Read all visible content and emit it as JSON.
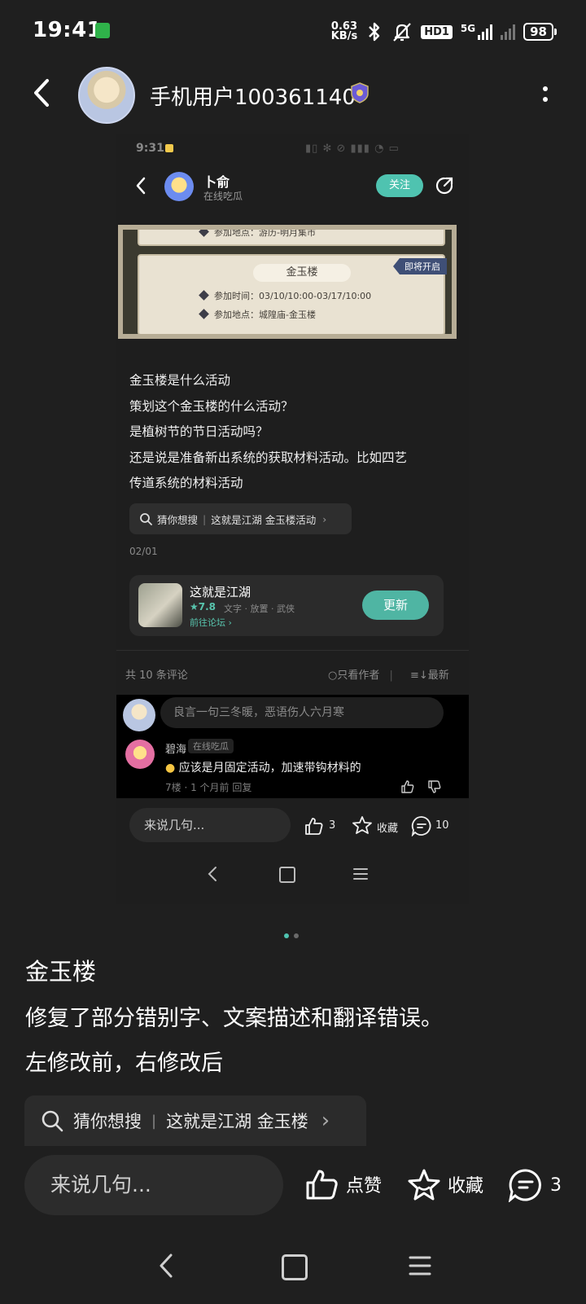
{
  "status_bar": {
    "time": "19:41",
    "net_speed_top": "0.63",
    "net_speed_bottom": "KB/s",
    "hd_label": "HD1",
    "network": "5G",
    "battery": "98"
  },
  "header": {
    "username": "手机用户100361140",
    "icons": [
      "back-arrow-icon",
      "avatar",
      "badge-icon",
      "more-vertical-icon"
    ]
  },
  "embedded_screenshot": {
    "status": {
      "time": "9:31"
    },
    "header": {
      "name": "卜俞",
      "subtitle": "在线吃瓜",
      "follow_label": "关注"
    },
    "game_image": {
      "row1_label": "参加地点：游历-明月集市",
      "card_title": "金玉楼",
      "ribbon": "即将开启",
      "time_label": "参加时间：03/10/10:00-03/17/10:00",
      "place_label": "参加地点：城隍庙-金玉楼"
    },
    "body_lines": [
      "金玉楼是什么活动",
      "策划这个金玉楼的什么活动？",
      "是植树节的节日活动吗？",
      "还是说是准备新出系统的获取材料活动。比如四艺",
      "传道系统的材料活动"
    ],
    "search": {
      "prefix": "猜你想搜",
      "query": "这就是江湖 金玉楼活动"
    },
    "date": "02/01",
    "game_card": {
      "name": "这就是江湖",
      "rating": "★7.8",
      "tags": "文字 · 放置 · 武侠",
      "forum_link": "前往论坛 ›",
      "update_label": "更新"
    },
    "comments_header": {
      "count": "共 10 条评论",
      "author_only": "只看作者",
      "latest": "最新"
    },
    "comment_input_placeholder": "良言一句三冬暖，恶语伤人六月寒",
    "comment": {
      "name": "碧海",
      "tag": "在线吃瓜",
      "text": "应该是月固定活动，加速带钩材料的",
      "meta": "7楼 · 1 个月前  回复"
    },
    "bottom_bar": {
      "input_placeholder": "来说几句...",
      "like_count": "3",
      "fav_label": "收藏",
      "comment_count": "10"
    }
  },
  "carousel": {
    "total": 2,
    "active": 0,
    "active_color": "#4fc3b0",
    "inactive_color": "#6a6a6a"
  },
  "post": {
    "title": "金玉楼",
    "line1": "修复了部分错别字、文案描述和翻译错误。",
    "line2": "左修改前，右修改后"
  },
  "search_suggest": {
    "prefix": "猜你想搜",
    "query": "这就是江湖 金玉楼"
  },
  "bottom_bar": {
    "input_placeholder": "来说几句...",
    "like_label": "点赞",
    "fav_label": "收藏",
    "comment_count": "3"
  },
  "colors": {
    "background": "#1f1f1f",
    "accent": "#4fc3b0"
  }
}
